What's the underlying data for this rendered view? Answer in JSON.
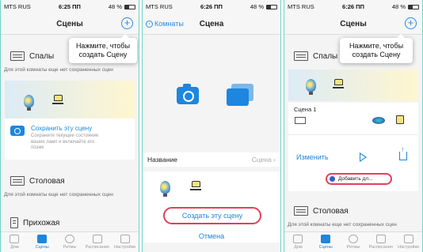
{
  "status": {
    "carrier": "MTS RUS",
    "time1": "6:25 ПП",
    "time2": "6:26 ПП",
    "time3": "6:26 ПП",
    "battery": "48 %"
  },
  "nav": {
    "scenes_title": "Сцены",
    "scene_title": "Сцена",
    "back_label": "Комнаты",
    "add_symbol": "+"
  },
  "tooltip": "Нажмите, чтобы создать Сцену",
  "rooms": {
    "bedroom": "Спальня",
    "bedroom_short": "Спалы",
    "dining": "Столовая",
    "hall": "Прихожая",
    "no_scenes_note": "Для этой комнаты еще нет сохраненных сцен",
    "no_scenes_note_short": "Для этой комнаты еще нет сохраненных сцен"
  },
  "save_scene": {
    "link": "Сохранить эту сцену",
    "description": "Сохраните текущее состояние ваших ламп и включайте его позже"
  },
  "scene_form": {
    "name_label": "Название",
    "name_value": "Сцена",
    "create_button": "Создать эту сцену",
    "cancel_button": "Отмена"
  },
  "scene1": {
    "name": "Сцена 1",
    "edit": "Изменить",
    "add_widget": "Добавить дл..."
  },
  "tabs": [
    "Дом",
    "Сцены",
    "Ритмы",
    "Расписания",
    "Настройки"
  ],
  "colors": {
    "accent": "#1c86e0",
    "highlight": "#e0405c",
    "frame": "#6fd3c7"
  }
}
